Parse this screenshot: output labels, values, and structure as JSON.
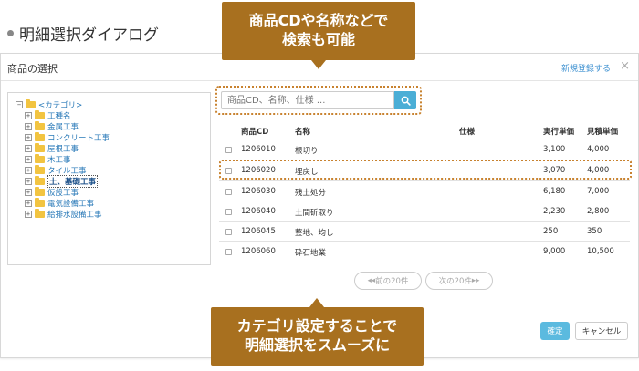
{
  "page": {
    "heading": "明細選択ダイアログ"
  },
  "dialog": {
    "title": "商品の選択",
    "new_register_link": "新規登録する",
    "close_glyph": "×"
  },
  "tree": {
    "root": {
      "toggle": "−",
      "label": "<カテゴリ>"
    },
    "items": [
      {
        "toggle": "+",
        "label": "工種名"
      },
      {
        "toggle": "+",
        "label": "金属工事"
      },
      {
        "toggle": "+",
        "label": "コンクリート工事"
      },
      {
        "toggle": "+",
        "label": "屋根工事"
      },
      {
        "toggle": "+",
        "label": "木工事"
      },
      {
        "toggle": "+",
        "label": "タイル工事"
      },
      {
        "toggle": "+",
        "label": "土、基礎工事",
        "selected": true
      },
      {
        "toggle": "+",
        "label": "仮設工事"
      },
      {
        "toggle": "+",
        "label": "電気設備工事"
      },
      {
        "toggle": "+",
        "label": "給排水設備工事"
      }
    ]
  },
  "search": {
    "placeholder": "商品CD、名称、仕様 ...",
    "button_icon": "search-icon"
  },
  "table": {
    "columns": [
      "商品CD",
      "名称",
      "仕様",
      "実行単価",
      "見積単価"
    ],
    "rows": [
      {
        "code": "1206010",
        "name": "根切り",
        "spec": "",
        "exec_price": "3,100",
        "quote_price": "4,000"
      },
      {
        "code": "1206020",
        "name": "埋戻し",
        "spec": "",
        "exec_price": "3,070",
        "quote_price": "4,000"
      },
      {
        "code": "1206030",
        "name": "残土処分",
        "spec": "",
        "exec_price": "6,180",
        "quote_price": "7,000"
      },
      {
        "code": "1206040",
        "name": "土間斫取り",
        "spec": "",
        "exec_price": "2,230",
        "quote_price": "2,800"
      },
      {
        "code": "1206045",
        "name": "整地、均し",
        "spec": "",
        "exec_price": "250",
        "quote_price": "350"
      },
      {
        "code": "1206060",
        "name": "砕石地業",
        "spec": "",
        "exec_price": "9,000",
        "quote_price": "10,500"
      }
    ]
  },
  "pagination": {
    "prev_label": "前の20件",
    "next_label": "次の20件"
  },
  "footer": {
    "ok_label": "確定",
    "cancel_label": "キャンセル"
  },
  "callouts": {
    "top": [
      "商品CDや名称などで",
      "検索も可能"
    ],
    "bottom": [
      "カテゴリ設定することで",
      "明細選択をスムーズに"
    ]
  },
  "colors": {
    "accent_blue": "#4aaed6",
    "link_blue": "#3b8fd0",
    "callout_brown": "#a8701f",
    "folder_yellow": "#f2c441"
  }
}
